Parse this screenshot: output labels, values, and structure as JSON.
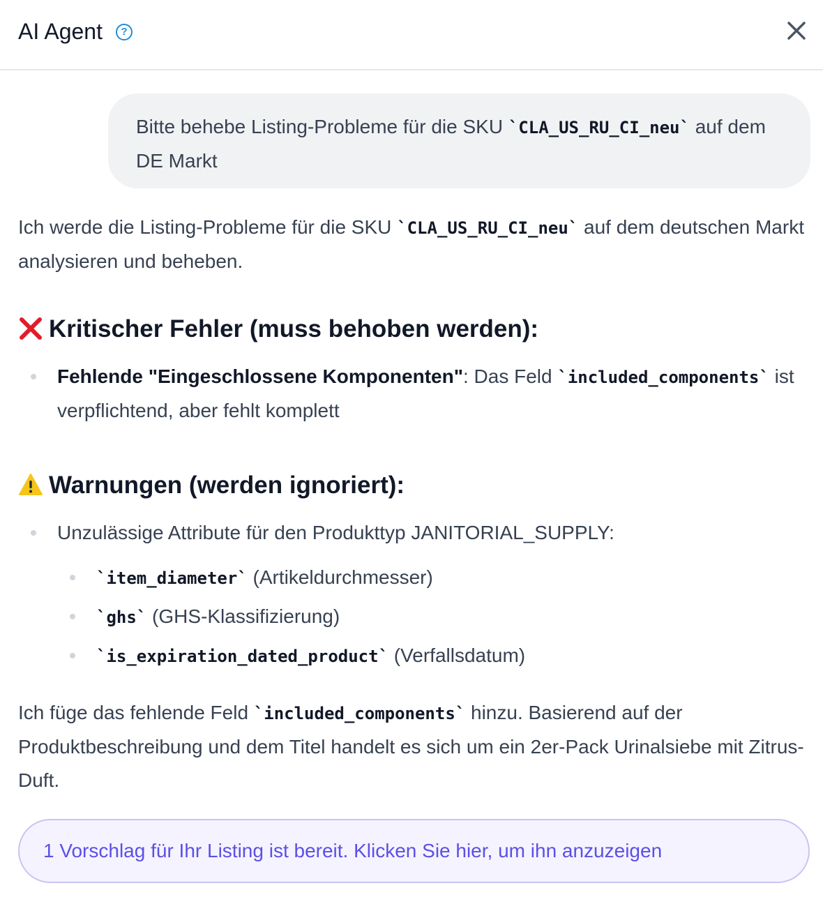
{
  "header": {
    "title": "AI Agent",
    "help_icon": "question-circle-icon",
    "close_icon": "close-icon"
  },
  "user_message": {
    "text_before": "Bitte behebe Listing-Probleme für die SKU ",
    "sku": "`CLA_US_RU_CI_neu`",
    "text_after": " auf dem DE Markt"
  },
  "intro": {
    "text_before": "Ich werde die Listing-Probleme für die SKU ",
    "sku": "`CLA_US_RU_CI_neu`",
    "text_after": " auf dem deutschen Markt analysieren und beheben."
  },
  "critical": {
    "emoji": "❌",
    "heading": "Kritischer Fehler (muss behoben werden):",
    "bullet_bold": "Fehlende \"Eingeschlossene Komponenten\"",
    "bullet_text": ": Das Feld ",
    "bullet_code": "`included_components`",
    "bullet_text2": " ist verpflichtend, aber fehlt komplett"
  },
  "warnings": {
    "emoji": "⚠️",
    "heading": "Warnungen (werden ignoriert):",
    "bullet_text": "Unzulässige Attribute für den Produkttyp JANITORIAL_SUPPLY:",
    "sub_items": [
      {
        "code": "`item_diameter`",
        "text": " (Artikeldurchmesser)"
      },
      {
        "code": "`ghs`",
        "text": " (GHS-Klassifizierung)"
      },
      {
        "code": "`is_expiration_dated_product`",
        "text": " (Verfallsdatum)"
      }
    ]
  },
  "conclusion": {
    "text_before": "Ich füge das fehlende Feld ",
    "code": "`included_components`",
    "text_after": " hinzu. Basierend auf der Produktbeschreibung und dem Titel handelt es sich um ein 2er-Pack Urinalsiebe mit Zitrus-Duft."
  },
  "suggestion": {
    "label": "1 Vorschlag für Ihr Listing ist bereit. Klicken Sie hier, um ihn anzuzeigen"
  },
  "colors": {
    "accent": "#5b50e6",
    "help_blue": "#1d8fd8",
    "bubble_bg": "#f1f2f4",
    "critical_red": "#e11d2a",
    "warning_yellow": "#f5c518"
  }
}
